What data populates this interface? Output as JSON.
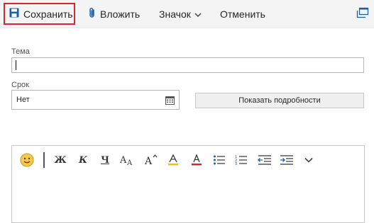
{
  "toolbar": {
    "save_label": "Сохранить",
    "attach_label": "Вложить",
    "badge_label": "Значок",
    "cancel_label": "Отменить",
    "accent_color": "#1e5ea8",
    "highlight_color": "#d6262e",
    "icons": [
      "save-icon",
      "paperclip-icon",
      "chevron-down-icon",
      "popout-icon"
    ]
  },
  "form": {
    "subject_label": "Тема",
    "subject_value": "",
    "due_label": "Срок",
    "due_value": "Нет",
    "details_button": "Показать подробности"
  },
  "editor": {
    "toolbar_icons": [
      "emoji-icon",
      "bold-icon",
      "italic-icon",
      "underline-icon",
      "font-size-icon",
      "grow-font-icon",
      "highlight-icon",
      "font-color-icon",
      "bullets-icon",
      "numbering-icon",
      "decrease-indent-icon",
      "increase-indent-icon",
      "more-options-icon"
    ],
    "glyphs": {
      "bold": "Ж",
      "italic": "К",
      "underline": "Ч"
    },
    "highlight_color": "#f2c200",
    "font_color": "#d6262e"
  }
}
